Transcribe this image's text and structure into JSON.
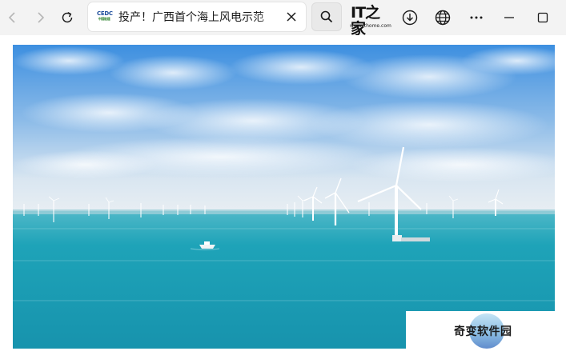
{
  "browser": {
    "tab_title": "投产！广西首个海上风电示范",
    "favicon_text": "CEDC",
    "favicon_subtext": "中国能建"
  },
  "toolbar": {
    "ithome_logo_text": "IT之家",
    "ithome_logo_url_text": "www.ithome.com"
  },
  "icons": {
    "back": "back-arrow-icon",
    "forward": "forward-arrow-icon",
    "refresh": "refresh-icon",
    "close_tab": "close-icon",
    "search": "search-icon",
    "downloads": "download-icon",
    "globe": "globe-icon",
    "more": "more-icon",
    "minimize": "minimize-icon",
    "maximize": "maximize-icon"
  },
  "watermark": {
    "text": "奇变软件园"
  },
  "colors": {
    "sky_top": "#3d8fe0",
    "sea": "#1ea3b8"
  }
}
